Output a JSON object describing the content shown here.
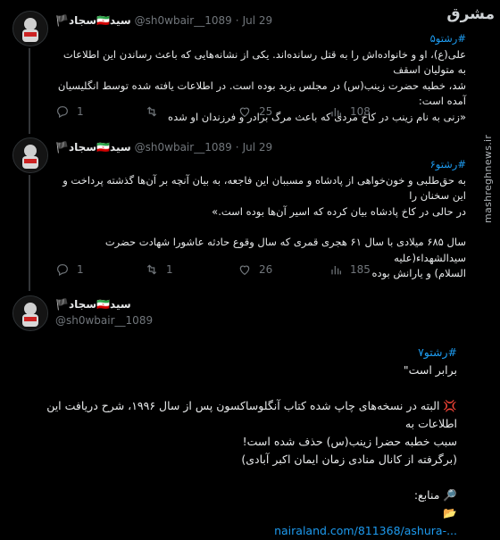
{
  "watermark": {
    "logo": "مشرق",
    "url": "mashreghnews.ir"
  },
  "tweets": [
    {
      "display_name": "سید🇮🇷سجاد🏴",
      "handle": "@sh0wbair__1089",
      "date": "Jul 29",
      "hashtag": "#رشتو۵",
      "lines": [
        "علی(ع)، او و خانواده‌اش را به قتل رسانده‌اند. یکی از نشانه‌هایی که باعث رساندن این اطلاعات به متولیان اسقف",
        "شد، خطبه حضرت زینب(س) در مجلس یزید بوده است. در اطلاعات یافته شده توسط انگلیسیان آمده است:",
        "«زنی به نام زینب در کاخ مردی که باعث مرگ برادر و فرزندان او شده"
      ],
      "replies": "1",
      "retweets": "",
      "likes": "25",
      "views": "108"
    },
    {
      "display_name": "سید🇮🇷سجاد🏴",
      "handle": "@sh0wbair__1089",
      "date": "Jul 29",
      "hashtag": "#رشتو۶",
      "lines": [
        "به حق‌طلبی و خون‌خواهی از پادشاه و مسببان این فاجعه، به بیان آنچه بر آن‌ها گذشته پرداخت و این سخنان را",
        "در حالی در کاخ پادشاه بیان کرده که اسیر آن‌ها بوده است.»",
        "",
        "سال ۶۸۵ میلادی با سال ۶۱ هجری قمری که سال وقوع حادثه عاشورا شهادت حضرت سیدالشهداء(علیه",
        "السلام) و یارانش بوده"
      ],
      "replies": "1",
      "retweets": "1",
      "likes": "26",
      "views": "185"
    }
  ],
  "main_tweet": {
    "display_name": "سید🇮🇷سجاد🏴",
    "handle": "@sh0wbair__1089",
    "hashtag": "#رشتو۷",
    "lines": [
      "برابر است\"",
      "",
      "💢 البته در نسخه‌های چاپ شده کتاب آنگلوساکسون پس از سال ۱۹۹۶، شرح دریافت این اطلاعات به",
      "سبب خطبه حضرا زینب(س) حذف شده است!",
      "(برگرفته از کانال منادی زمان ایمان اکبر آبادی)",
      "",
      "🔎 منابع:",
      "📂"
    ],
    "link": "nairaland.com/811368/ashura-..."
  }
}
